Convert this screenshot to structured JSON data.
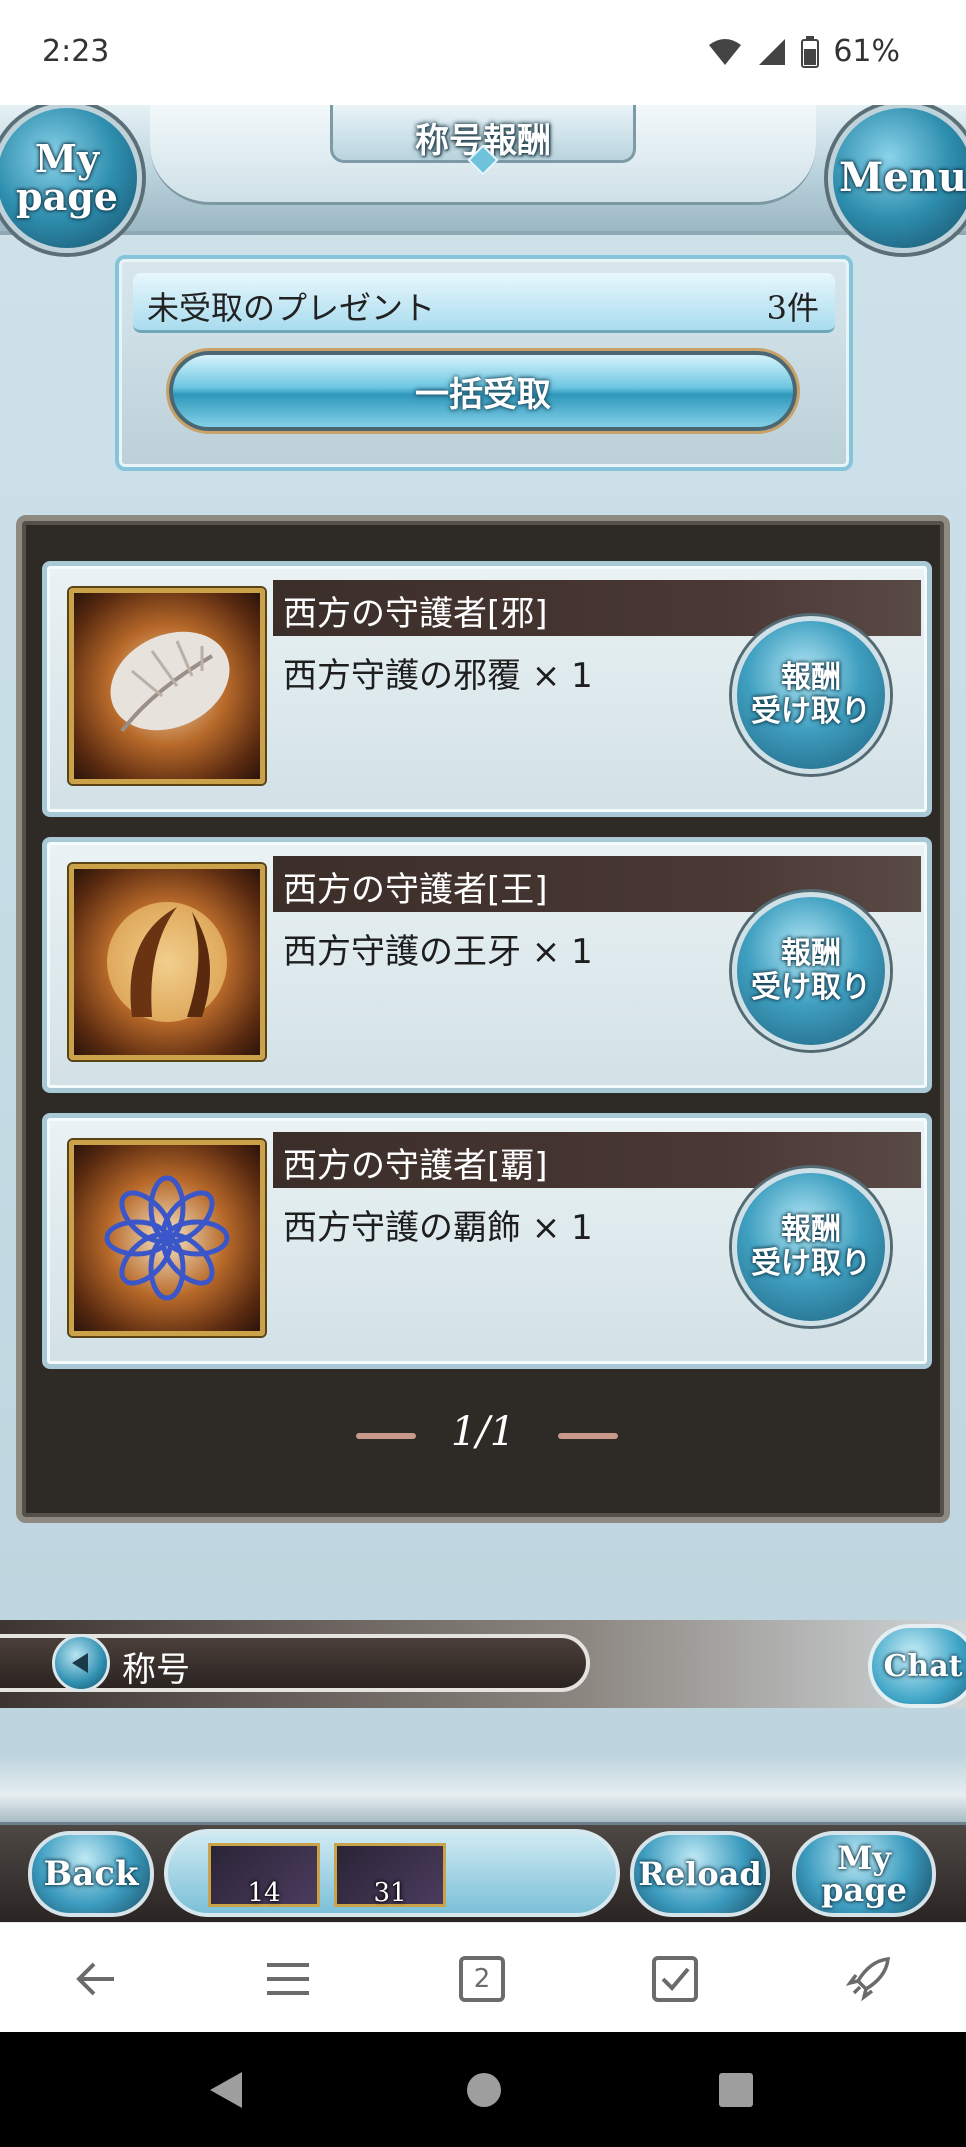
{
  "status_bar": {
    "time": "2:23",
    "battery": "61%"
  },
  "header": {
    "title": "称号報酬",
    "mypage_label": "My page",
    "menu_label": "Menu"
  },
  "present": {
    "label": "未受取のプレゼント",
    "count": "3件",
    "bulk_button": "一括受取"
  },
  "rewards": [
    {
      "title": "西方の守護者[邪]",
      "item": "西方守護の邪覆 × 1",
      "claim_line1": "報酬",
      "claim_line2": "受け取り",
      "icon": "feather-icon"
    },
    {
      "title": "西方の守護者[王]",
      "item": "西方守護の王牙 × 1",
      "claim_line1": "報酬",
      "claim_line2": "受け取り",
      "icon": "fang-icon"
    },
    {
      "title": "西方の守護者[覇]",
      "item": "西方守護の覇飾 × 1",
      "claim_line1": "報酬",
      "claim_line2": "受け取り",
      "icon": "flower-ornament-icon"
    }
  ],
  "pager": {
    "text": "1/1"
  },
  "subnav": {
    "label": "称号",
    "chat": "Chat"
  },
  "toolbar": {
    "back": "Back",
    "reload": "Reload",
    "mypage": "My page",
    "items": [
      {
        "icon": "crystal-orb-icon",
        "count": "14"
      },
      {
        "icon": "crystal-shard-icon",
        "count": "31"
      }
    ]
  },
  "browser_nav": {
    "tab_count": "2"
  },
  "colors": {
    "accent": "#3f9fc0",
    "panel": "#2e2a26",
    "background": "#c7dde6"
  }
}
